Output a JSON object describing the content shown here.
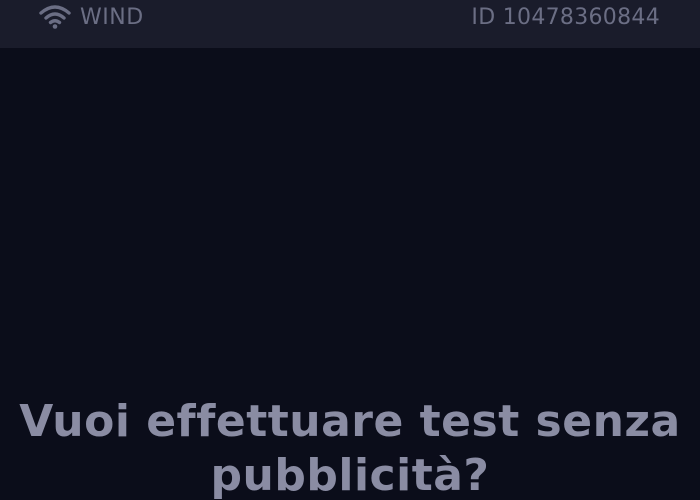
{
  "status_bar": {
    "wifi_icon": "wifi-icon",
    "carrier": "WIND",
    "device_id": "ID 10478360844"
  },
  "main": {
    "headline": "Vuoi effettuare test senza pubblicità?"
  },
  "colors": {
    "background": "#0b0d1a",
    "status_bar_bg": "#1a1c2b",
    "status_text": "#6b6e84",
    "headline_text": "#8a8ca3"
  }
}
